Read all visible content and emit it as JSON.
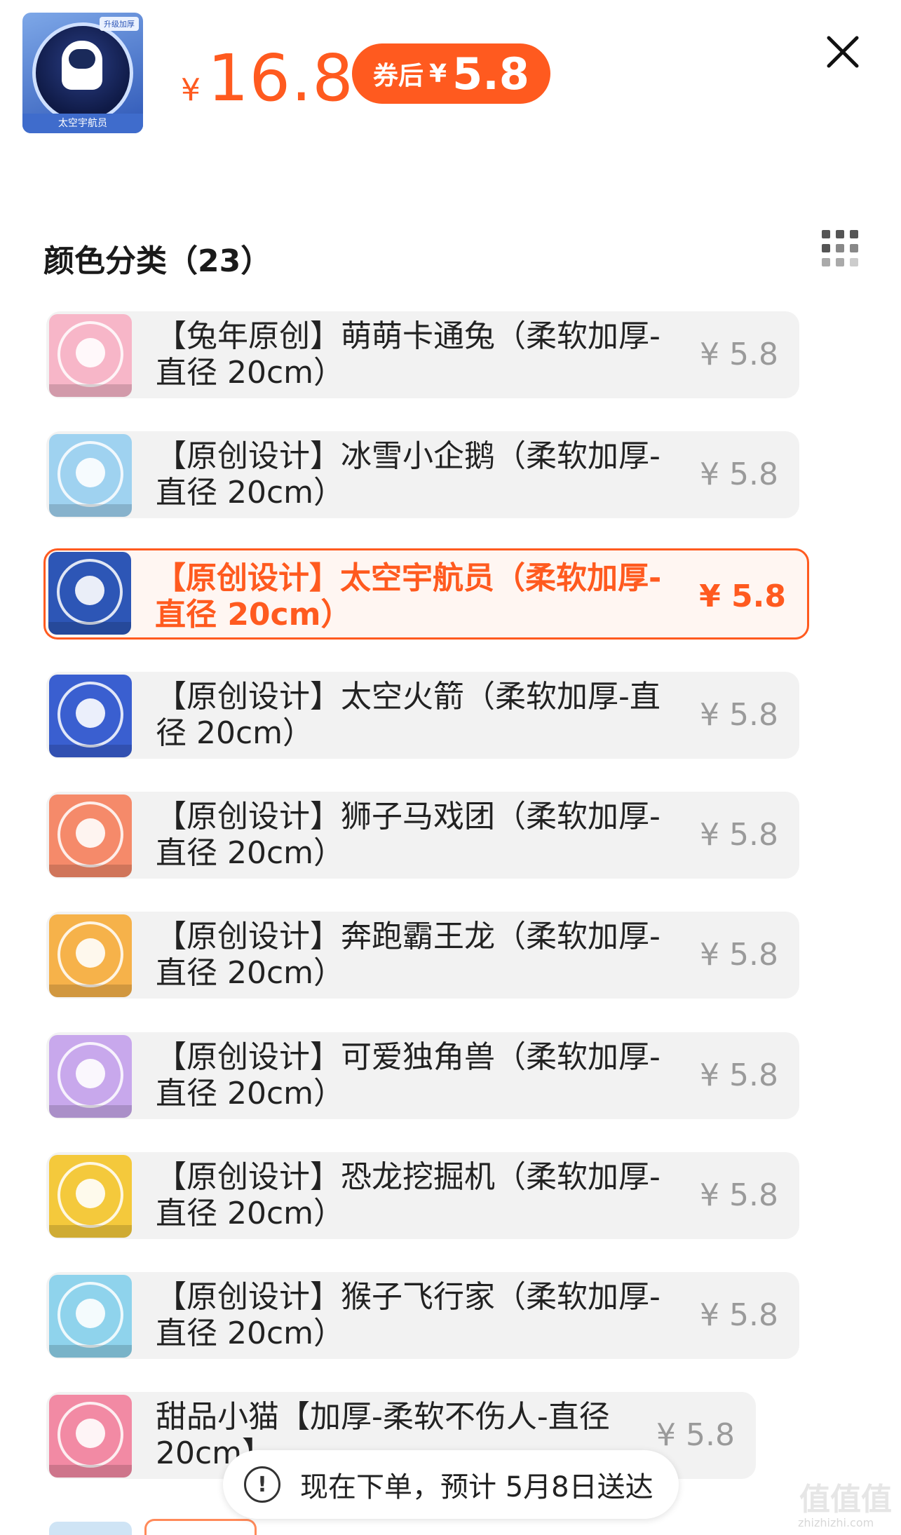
{
  "header": {
    "main_thumbnail": {
      "caption": "太空宇航员",
      "tag": "升级加厚",
      "icon": "astronaut-product-image"
    },
    "price": {
      "currency": "¥",
      "value": "16.8"
    },
    "coupon": {
      "label": "券后",
      "currency": "¥",
      "value": "5.8"
    },
    "close_icon": "close-icon"
  },
  "section": {
    "title": "颜色分类（23）",
    "view_toggle_icon": "grid-view-icon"
  },
  "options": [
    {
      "line1": "【兔年原创】萌萌卡通兔（柔软加厚-",
      "line2": "直径 20cm）",
      "price": "¥ 5.8",
      "selected": false,
      "thumb_color": "#f7b6c8"
    },
    {
      "line1": "【原创设计】冰雪小企鹅（柔软加厚-",
      "line2": "直径 20cm）",
      "price": "¥ 5.8",
      "selected": false,
      "thumb_color": "#9fd2f0"
    },
    {
      "line1": "【原创设计】太空宇航员（柔软加厚-",
      "line2": "直径 20cm）",
      "price": "¥ 5.8",
      "selected": true,
      "thumb_color": "#2d56b6"
    },
    {
      "line1": "【原创设计】太空火箭（柔软加厚-直",
      "line2": "径 20cm）",
      "price": "¥ 5.8",
      "selected": false,
      "thumb_color": "#3a5fd0"
    },
    {
      "line1": "【原创设计】狮子马戏团（柔软加厚-",
      "line2": "直径 20cm）",
      "price": "¥ 5.8",
      "selected": false,
      "thumb_color": "#f58a6a"
    },
    {
      "line1": "【原创设计】奔跑霸王龙（柔软加厚-",
      "line2": "直径 20cm）",
      "price": "¥ 5.8",
      "selected": false,
      "thumb_color": "#f6b24a"
    },
    {
      "line1": "【原创设计】可爱独角兽（柔软加厚-",
      "line2": "直径 20cm）",
      "price": "¥ 5.8",
      "selected": false,
      "thumb_color": "#c8a8ec"
    },
    {
      "line1": "【原创设计】恐龙挖掘机（柔软加厚-",
      "line2": "直径 20cm）",
      "price": "¥ 5.8",
      "selected": false,
      "thumb_color": "#f4c93c"
    },
    {
      "line1": "【原创设计】猴子飞行家（柔软加厚-",
      "line2": "直径 20cm）",
      "price": "¥ 5.8",
      "selected": false,
      "thumb_color": "#8fd3ec"
    },
    {
      "line1": "甜品小猫【加厚-柔软不伤人-直径",
      "line2": "20cm】",
      "price": "¥ 5.8",
      "selected": false,
      "thumb_color": "#f28aa4"
    }
  ],
  "delivery": {
    "info_icon": "info-icon",
    "text": "现在下单，预计 5月8日送达"
  },
  "watermark": {
    "text": "值值值",
    "url": "zhizhizhi.com"
  },
  "colors": {
    "accent": "#ff5a1f",
    "muted_price": "#9a9a9a",
    "option_bg": "#f2f2f2"
  }
}
